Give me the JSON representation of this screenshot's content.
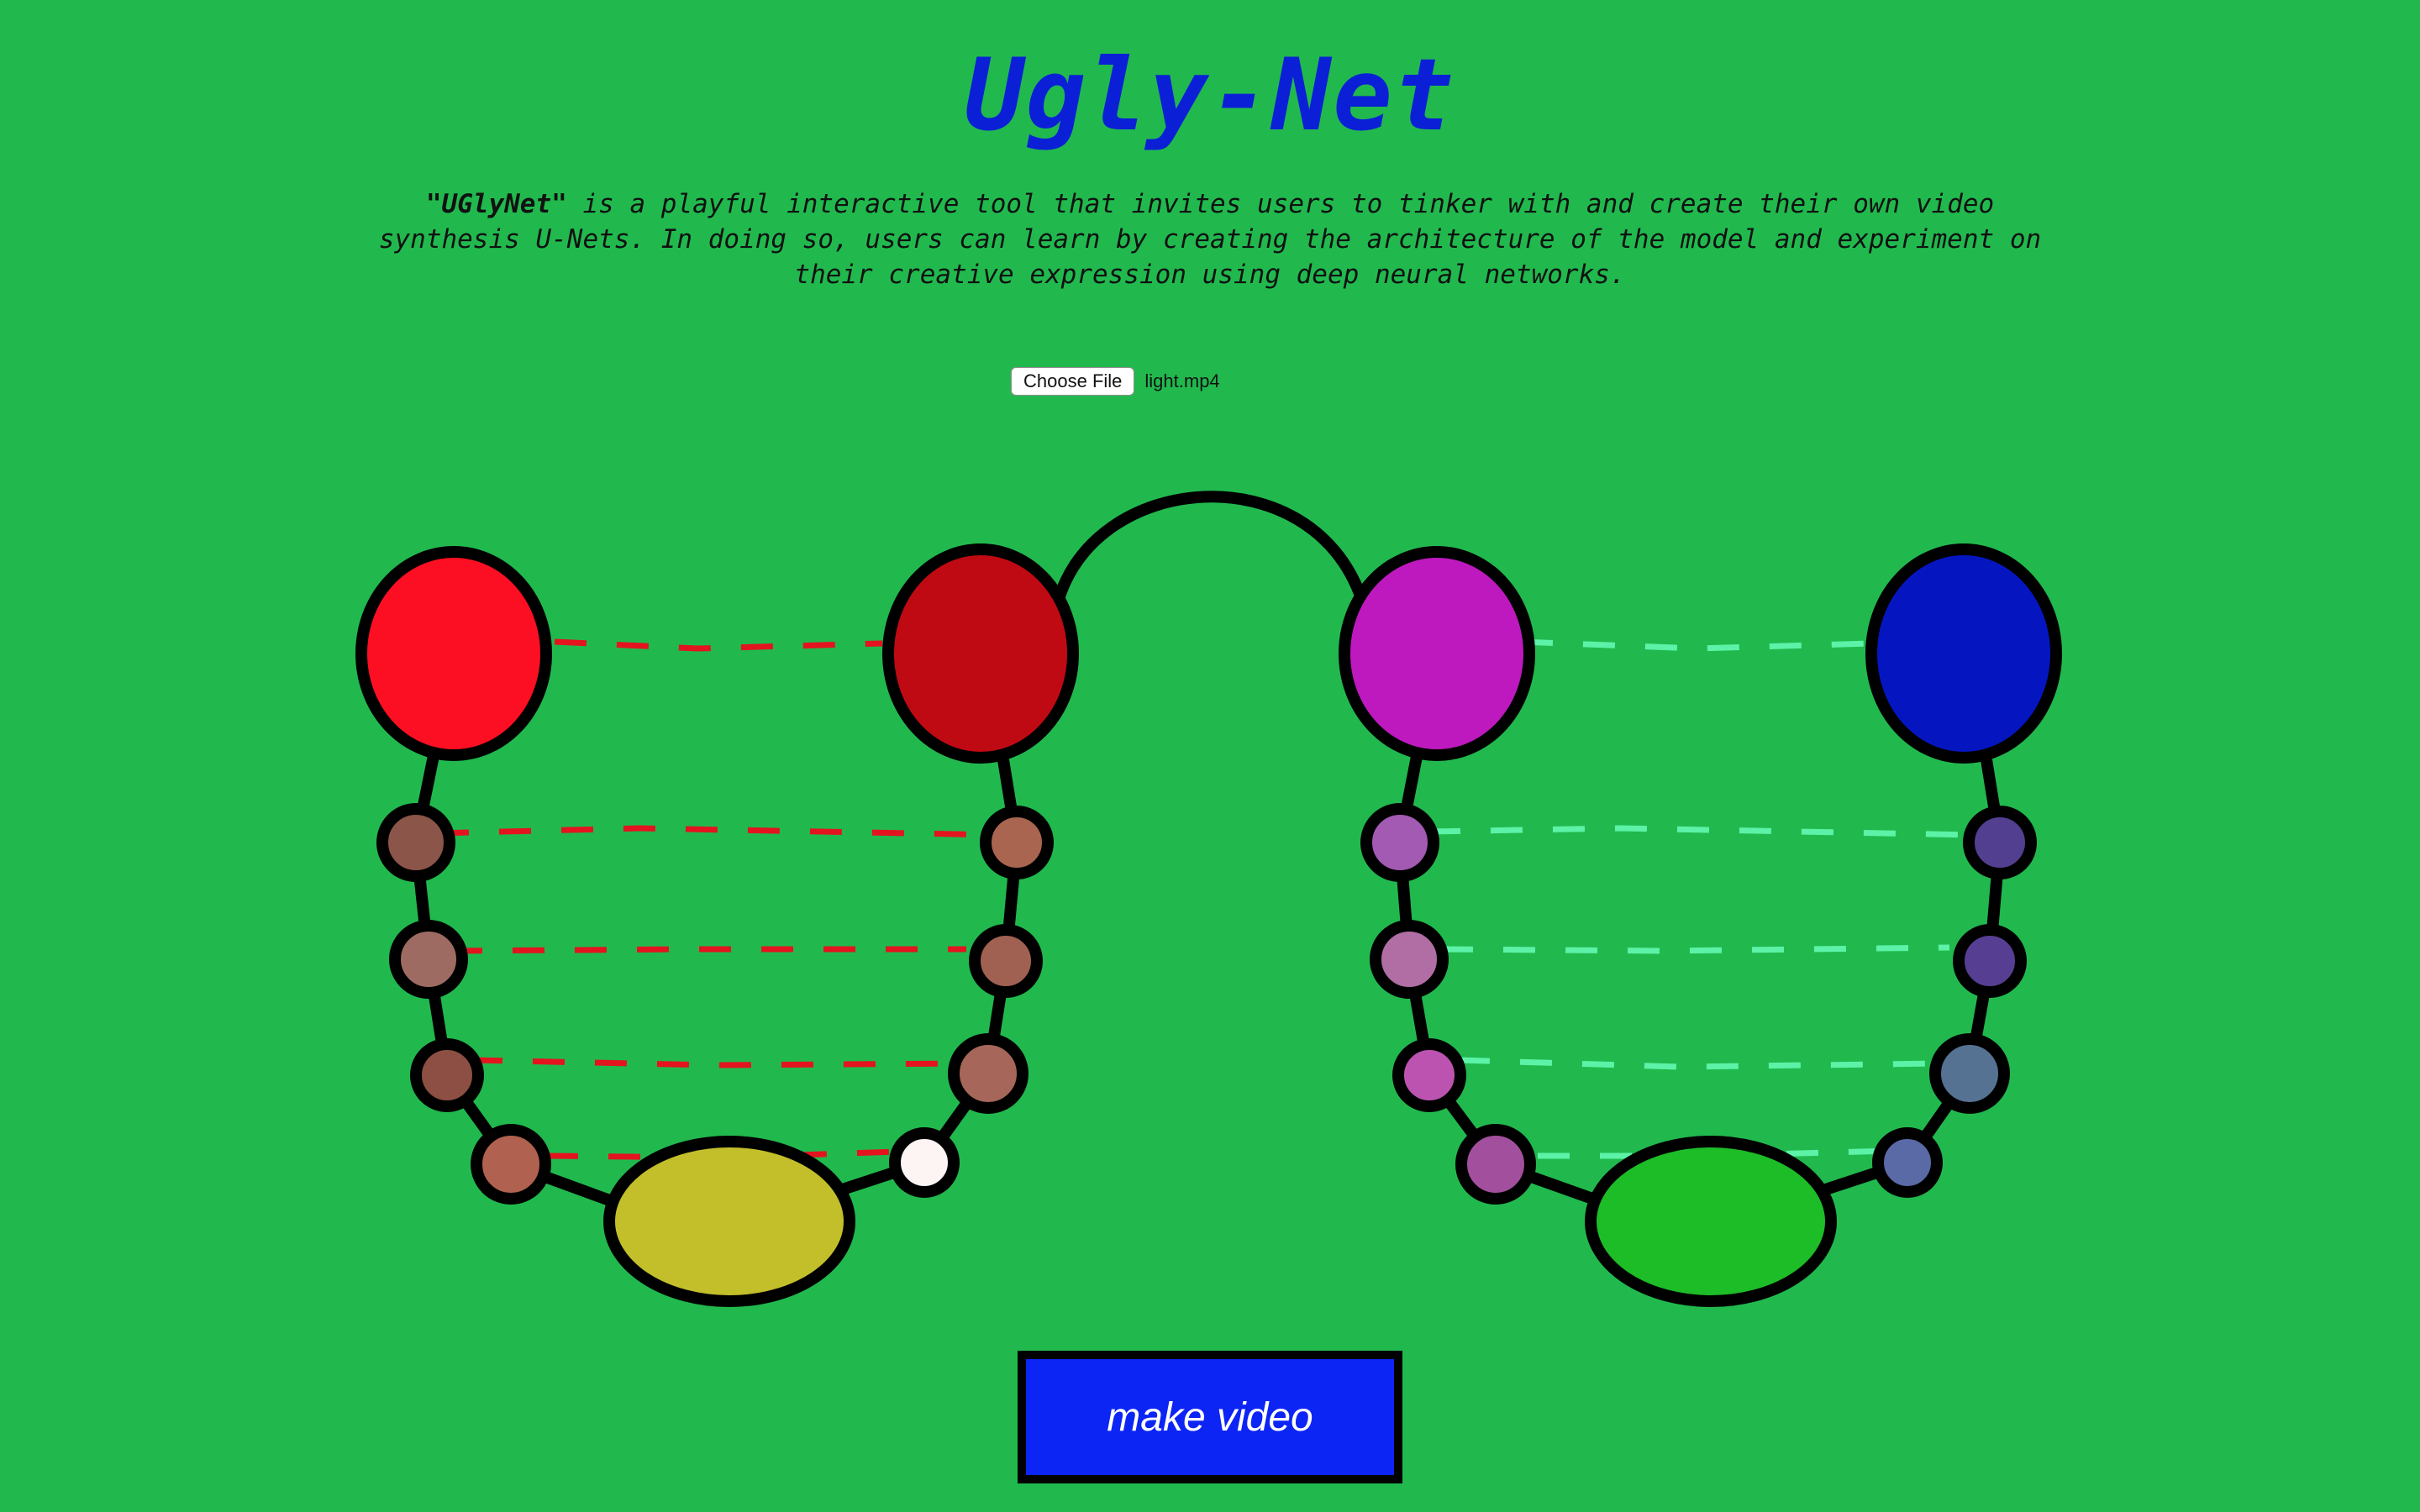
{
  "header": {
    "title": "Ugly-Net",
    "description_name": "\"UGlyNet\"",
    "description_text": " is a playful interactive tool that invites users to tinker with and create their own video synthesis U-Nets. In doing so, users can learn by creating the architecture of the model and experiment on their creative expression using deep neural networks."
  },
  "file_input": {
    "button_label": "Choose File",
    "file_name": "light.mp4"
  },
  "actions": {
    "make_video_label": "make video"
  },
  "unets": [
    {
      "side": "left",
      "top_left_color": "#fc0f22",
      "top_right_color": "#bf0a14",
      "node_colors_left": [
        "#8c5549",
        "#9e6b63",
        "#8d4f43",
        "#b0614f"
      ],
      "node_colors_right": [
        "#a96550",
        "#a06152",
        "#a6675a",
        "#fdf4f4"
      ],
      "bottom_color": "#c2bf2b",
      "skip_connection_color": "#e3141e"
    },
    {
      "side": "right",
      "top_left_color": "#be19bf",
      "top_right_color": "#0516c1",
      "node_colors_left": [
        "#a35ab3",
        "#b06ea5",
        "#bd53b0",
        "#a24f9d"
      ],
      "node_colors_right": [
        "#523f90",
        "#563f92",
        "#557293",
        "#5a6aa7"
      ],
      "bottom_color": "#1cbd27",
      "skip_connection_color": "#5cf2a7"
    }
  ],
  "bridge_color": "#000000"
}
